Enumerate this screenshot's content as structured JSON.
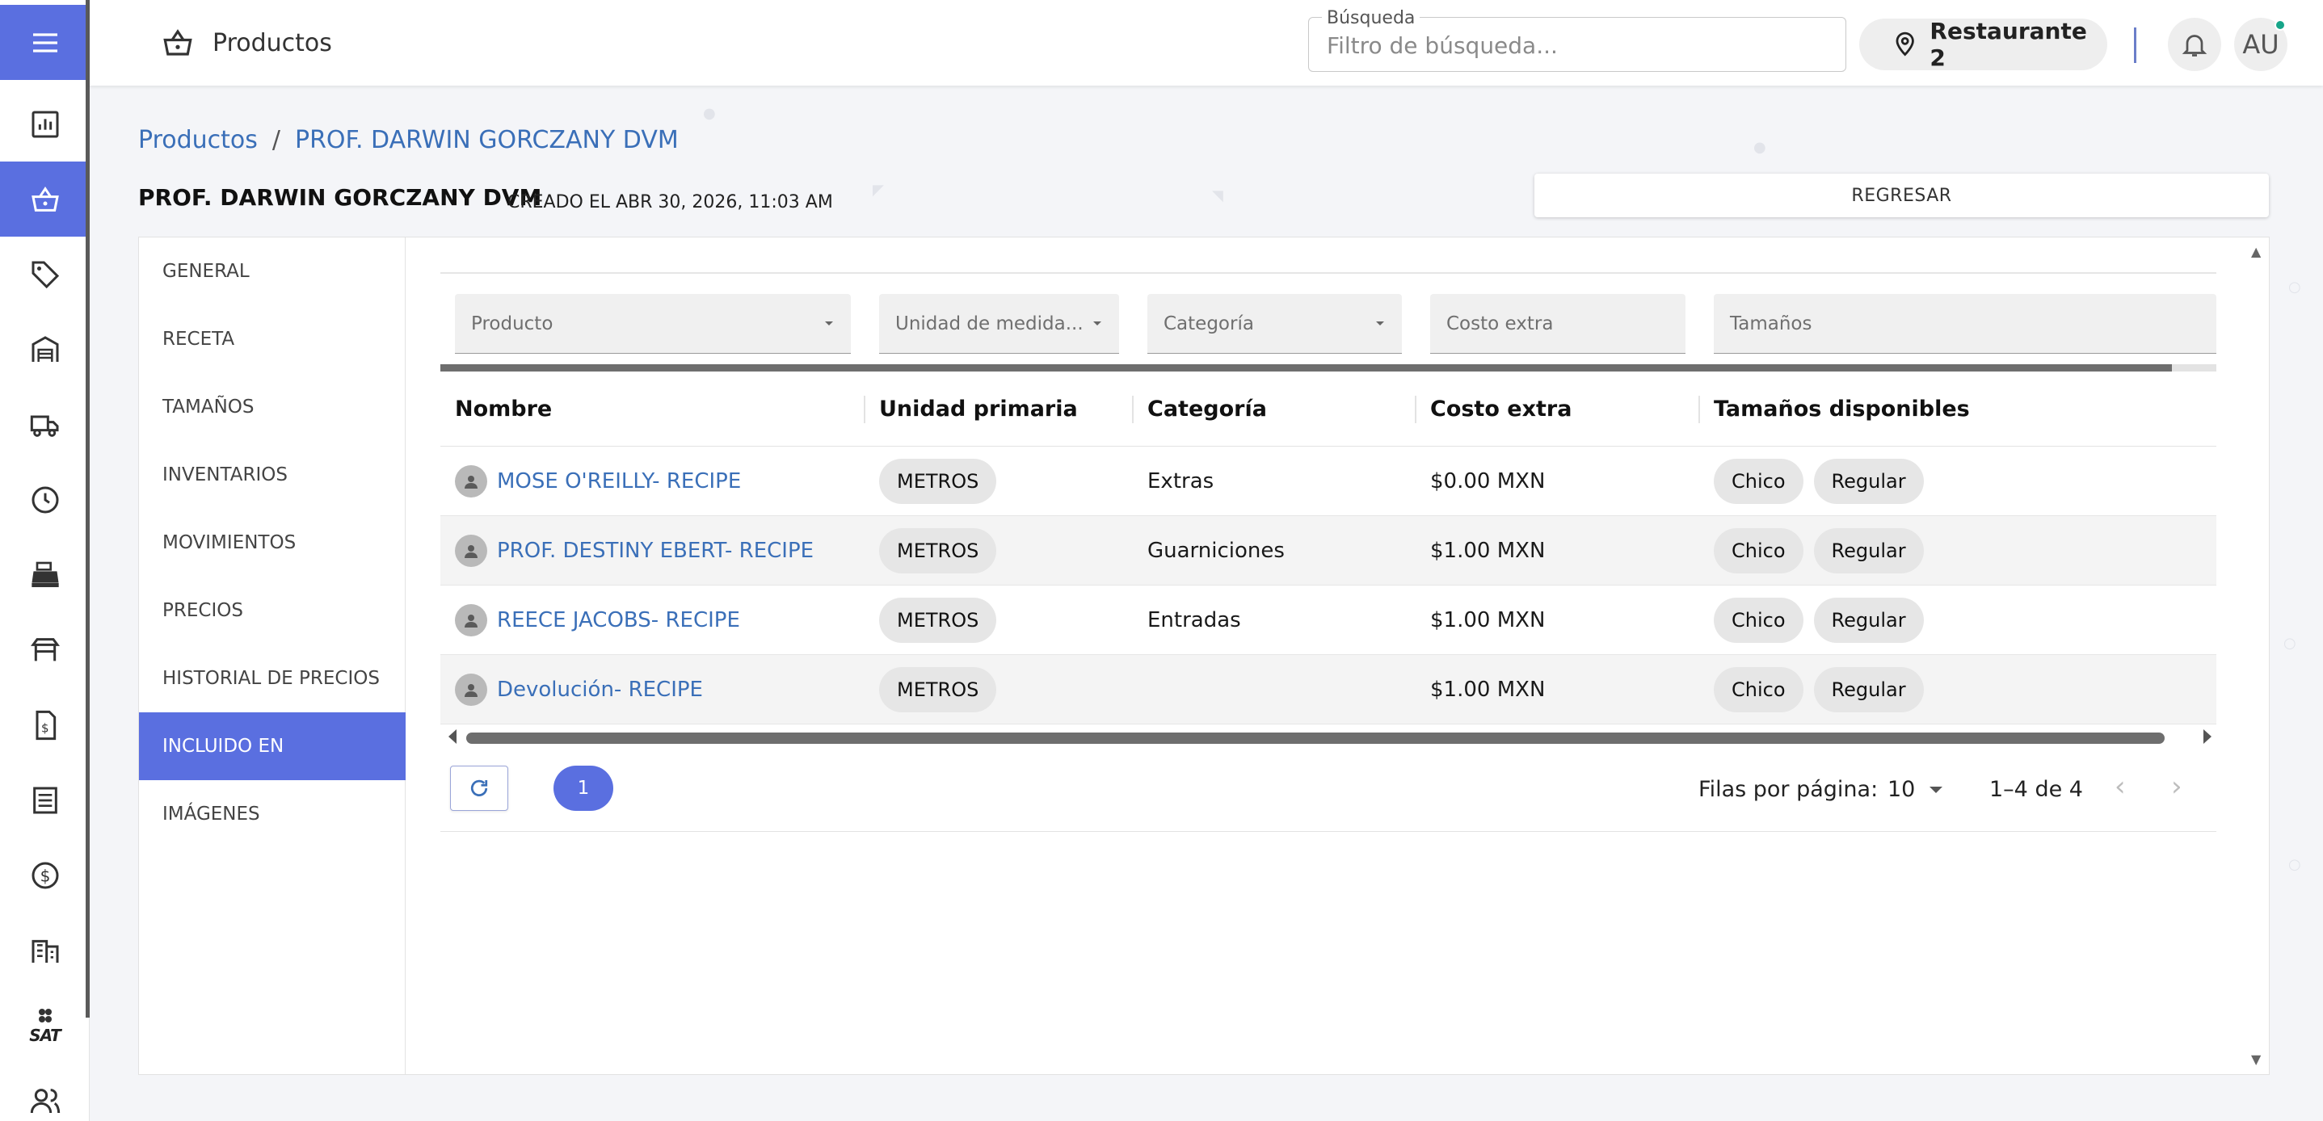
{
  "topbar": {
    "title": "Productos",
    "search_legend": "Búsqueda",
    "search_placeholder": "Filtro de búsqueda...",
    "location": "Restaurante 2",
    "avatar_initials": "AU"
  },
  "rail": {
    "items": [
      "menu-icon",
      "dashboard-icon",
      "basket-icon",
      "tag-icon",
      "warehouse-icon",
      "truck-icon",
      "clock-icon",
      "cash-register-icon",
      "table-icon",
      "invoice-icon",
      "list-icon",
      "dollar-icon",
      "building-icon",
      "sat-icon",
      "users-icon"
    ],
    "sat_label": "SAT",
    "active": "basket-icon"
  },
  "breadcrumb": {
    "root": "Productos",
    "separator": "/",
    "current": "PROF. DARWIN GORCZANY DVM"
  },
  "page": {
    "title": "PROF. DARWIN GORCZANY DVM",
    "created": "CREADO EL ABR 30, 2026, 11:03 AM",
    "back_label": "REGRESAR"
  },
  "sidenav": {
    "items": [
      "GENERAL",
      "RECETA",
      "TAMAÑOS",
      "INVENTARIOS",
      "MOVIMIENTOS",
      "PRECIOS",
      "HISTORIAL DE PRECIOS",
      "INCLUIDO EN",
      "IMÁGENES"
    ],
    "active": "INCLUIDO EN"
  },
  "filters": {
    "producto": "Producto",
    "unidad": "Unidad de medida...",
    "categoria": "Categoría",
    "costo": "Costo extra",
    "tamanos": "Tamaños"
  },
  "progress": 0.975,
  "table": {
    "headers": [
      "Nombre",
      "Unidad primaria",
      "Categoría",
      "Costo extra",
      "Tamaños disponibles"
    ],
    "rows": [
      {
        "nombre": "MOSE O'REILLY- RECIPE",
        "unidad": "METROS",
        "categoria": "Extras",
        "costo": "$0.00 MXN",
        "tamanos": [
          "Chico",
          "Regular"
        ]
      },
      {
        "nombre": "PROF. DESTINY EBERT- RECIPE",
        "unidad": "METROS",
        "categoria": "Guarniciones",
        "costo": "$1.00 MXN",
        "tamanos": [
          "Chico",
          "Regular"
        ]
      },
      {
        "nombre": "REECE JACOBS- RECIPE",
        "unidad": "METROS",
        "categoria": "Entradas",
        "costo": "$1.00 MXN",
        "tamanos": [
          "Chico",
          "Regular"
        ]
      },
      {
        "nombre": "Devolución- RECIPE",
        "unidad": "METROS",
        "categoria": "",
        "costo": "$1.00 MXN",
        "tamanos": [
          "Chico",
          "Regular"
        ]
      }
    ]
  },
  "pagination": {
    "current_page": "1",
    "rows_per_page_label": "Filas por página:",
    "rows_per_page": "10",
    "range": "1–4 de 4"
  },
  "colors": {
    "accent": "#5a6fe0",
    "link": "#3a6fb8",
    "notify": "#17a589"
  }
}
